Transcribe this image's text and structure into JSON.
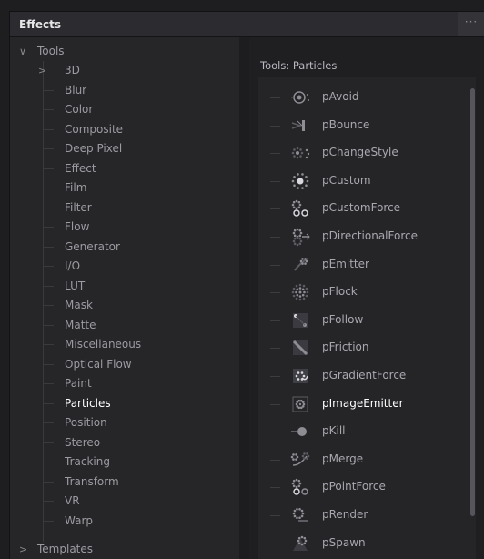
{
  "panel": {
    "title": "Effects",
    "menu_icon": "ellipsis-icon",
    "menu_glyph": "···"
  },
  "tree": {
    "root_label": "Tools",
    "items": [
      {
        "label": "3D",
        "expandable": true
      },
      {
        "label": "Blur"
      },
      {
        "label": "Color"
      },
      {
        "label": "Composite"
      },
      {
        "label": "Deep Pixel"
      },
      {
        "label": "Effect"
      },
      {
        "label": "Film"
      },
      {
        "label": "Filter"
      },
      {
        "label": "Flow"
      },
      {
        "label": "Generator"
      },
      {
        "label": "I/O"
      },
      {
        "label": "LUT"
      },
      {
        "label": "Mask"
      },
      {
        "label": "Matte"
      },
      {
        "label": "Miscellaneous"
      },
      {
        "label": "Optical Flow"
      },
      {
        "label": "Paint"
      },
      {
        "label": "Particles",
        "selected": true
      },
      {
        "label": "Position"
      },
      {
        "label": "Stereo"
      },
      {
        "label": "Tracking"
      },
      {
        "label": "Transform"
      },
      {
        "label": "VR"
      },
      {
        "label": "Warp"
      }
    ],
    "templates_label": "Templates"
  },
  "content": {
    "title": "Tools: Particles",
    "tools": [
      {
        "label": "pAvoid",
        "icon": "avoid-icon"
      },
      {
        "label": "pBounce",
        "icon": "bounce-icon"
      },
      {
        "label": "pChangeStyle",
        "icon": "change-style-icon"
      },
      {
        "label": "pCustom",
        "icon": "custom-icon"
      },
      {
        "label": "pCustomForce",
        "icon": "custom-force-icon"
      },
      {
        "label": "pDirectionalForce",
        "icon": "directional-force-icon"
      },
      {
        "label": "pEmitter",
        "icon": "emitter-icon"
      },
      {
        "label": "pFlock",
        "icon": "flock-icon"
      },
      {
        "label": "pFollow",
        "icon": "follow-icon"
      },
      {
        "label": "pFriction",
        "icon": "friction-icon"
      },
      {
        "label": "pGradientForce",
        "icon": "gradient-force-icon"
      },
      {
        "label": "pImageEmitter",
        "icon": "image-emitter-icon",
        "highlighted": true
      },
      {
        "label": "pKill",
        "icon": "kill-icon"
      },
      {
        "label": "pMerge",
        "icon": "merge-icon"
      },
      {
        "label": "pPointForce",
        "icon": "point-force-icon"
      },
      {
        "label": "pRender",
        "icon": "render-icon"
      },
      {
        "label": "pSpawn",
        "icon": "spawn-icon"
      }
    ]
  }
}
